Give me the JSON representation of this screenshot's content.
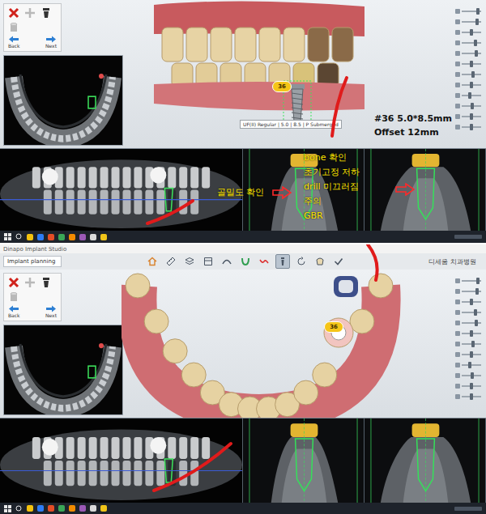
{
  "screens": [
    {
      "view": "side",
      "tools": [
        {
          "kind": "delete",
          "disabled": false
        },
        {
          "kind": "add",
          "disabled": true
        },
        {
          "kind": "implant",
          "disabled": false
        },
        {
          "kind": "sleeve",
          "disabled": true
        }
      ],
      "nav": [
        {
          "label": "Back",
          "kind": "back"
        },
        {
          "label": "Next",
          "kind": "next"
        }
      ],
      "implant_badge": "36",
      "implant_label": "UF(II) Regular | 5.0 | 8.5 | P Submerged",
      "spec_note": [
        "#36 5.0*8.5mm",
        "Offset 12mm"
      ],
      "checklist": [
        "bone 확인",
        "초기고정 저하",
        "drill 미끄러짐",
        "주의",
        "GBR"
      ],
      "density_note": "골밀도 확인",
      "view_sliders": [
        {
          "level": 0.85
        },
        {
          "level": 0.8
        },
        {
          "level": 0.5
        },
        {
          "level": 0.7
        },
        {
          "level": 0.75
        },
        {
          "level": 0.5
        },
        {
          "level": 0.6
        },
        {
          "level": 0.5
        },
        {
          "level": 0.4
        },
        {
          "level": 0.55
        },
        {
          "level": 0.5
        },
        {
          "level": 0.5
        }
      ],
      "taskbar_apps": [
        {
          "color": "#f4c20d"
        },
        {
          "color": "#2d7cf6"
        },
        {
          "color": "#e44d26"
        },
        {
          "color": "#3aa757"
        },
        {
          "color": "#f28b00"
        },
        {
          "color": "#9b59b6"
        },
        {
          "color": "#d9d9d9"
        },
        {
          "color": "#f0c419"
        }
      ]
    },
    {
      "view": "occlusal",
      "title": "Dinapo Implant Studio",
      "mode": "Implant planning",
      "clinic": "디세움 치과병원",
      "view_tools": [
        {
          "kind": "home",
          "selected": false
        },
        {
          "kind": "ruler",
          "selected": false
        },
        {
          "kind": "layers",
          "selected": false
        },
        {
          "kind": "panel",
          "selected": false
        },
        {
          "kind": "curve",
          "selected": false
        },
        {
          "kind": "arch",
          "selected": false
        },
        {
          "kind": "nerve",
          "selected": false
        },
        {
          "kind": "implant",
          "selected": true
        },
        {
          "kind": "rotate",
          "selected": false
        },
        {
          "kind": "crown",
          "selected": false
        },
        {
          "kind": "check",
          "selected": false
        }
      ],
      "tools": [
        {
          "kind": "delete",
          "disabled": false
        },
        {
          "kind": "add",
          "disabled": true
        },
        {
          "kind": "implant",
          "disabled": false
        },
        {
          "kind": "sleeve",
          "disabled": true
        }
      ],
      "nav": [
        {
          "label": "Back",
          "kind": "back"
        },
        {
          "label": "Next",
          "kind": "next"
        }
      ],
      "implant_badge": "36",
      "view_sliders": [
        {
          "level": 0.85
        },
        {
          "level": 0.8
        },
        {
          "level": 0.5
        },
        {
          "level": 0.7
        },
        {
          "level": 0.75
        },
        {
          "level": 0.5
        },
        {
          "level": 0.6
        },
        {
          "level": 0.5
        },
        {
          "level": 0.4
        },
        {
          "level": 0.55
        },
        {
          "level": 0.5
        },
        {
          "level": 0.5
        }
      ],
      "taskbar_apps": [
        {
          "color": "#f4c20d"
        },
        {
          "color": "#2d7cf6"
        },
        {
          "color": "#e44d26"
        },
        {
          "color": "#3aa757"
        },
        {
          "color": "#f28b00"
        },
        {
          "color": "#9b59b6"
        },
        {
          "color": "#d9d9d9"
        },
        {
          "color": "#f0c419"
        }
      ]
    }
  ]
}
